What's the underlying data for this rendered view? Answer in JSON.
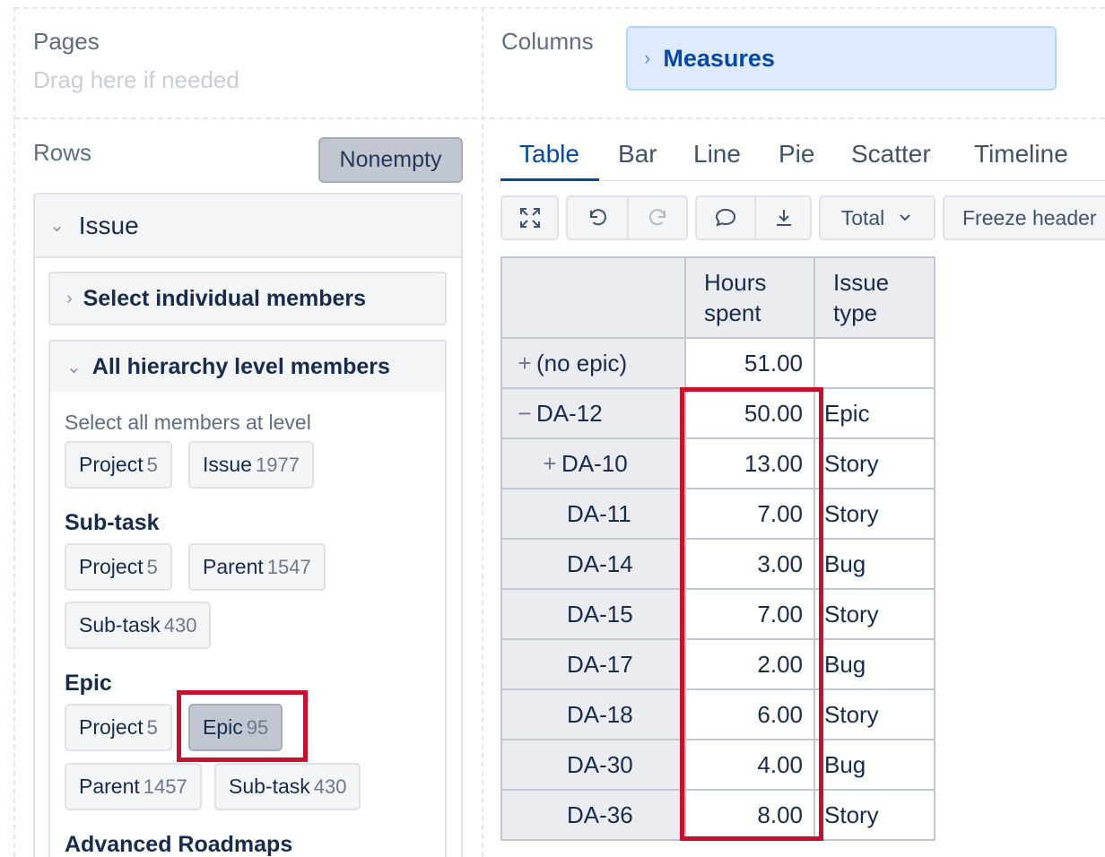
{
  "pages": {
    "title": "Pages",
    "hint": "Drag here if needed"
  },
  "columns": {
    "title": "Columns",
    "measures_label": "Measures"
  },
  "rows": {
    "title": "Rows",
    "nonempty_label": "Nonempty"
  },
  "dimension": {
    "title": "Issue"
  },
  "accordion": {
    "individual_members": "Select individual members",
    "hierarchy_level_members": "All hierarchy level members"
  },
  "levels": {
    "caption": "Select all members at level",
    "top": [
      {
        "label": "Project",
        "count": "5"
      },
      {
        "label": "Issue",
        "count": "1977"
      }
    ],
    "subtask": {
      "title": "Sub-task",
      "chips": [
        {
          "label": "Project",
          "count": "5"
        },
        {
          "label": "Parent",
          "count": "1547"
        },
        {
          "label": "Sub-task",
          "count": "430"
        }
      ]
    },
    "epic": {
      "title": "Epic",
      "chips": [
        {
          "label": "Project",
          "count": "5"
        },
        {
          "label": "Epic",
          "count": "95"
        },
        {
          "label": "Parent",
          "count": "1457"
        },
        {
          "label": "Sub-task",
          "count": "430"
        }
      ]
    },
    "advanced_roadmaps": {
      "title": "Advanced Roadmaps"
    }
  },
  "tabs": [
    "Table",
    "Bar",
    "Line",
    "Pie",
    "Scatter",
    "Timeline"
  ],
  "toolbar": {
    "total_label": "Total",
    "freeze_label": "Freeze header"
  },
  "table": {
    "headers": {
      "hours_line1": "Hours",
      "hours_line2": "spent",
      "type_line1": "Issue",
      "type_line2": "type"
    },
    "rows": [
      {
        "toggle": "+",
        "name": "(no epic)",
        "hours": "51.00",
        "type": ""
      },
      {
        "toggle": "−",
        "name": "DA-12",
        "hours": "50.00",
        "type": "Epic"
      },
      {
        "toggle": "+",
        "name": "DA-10",
        "hours": "13.00",
        "type": "Story"
      },
      {
        "toggle": "",
        "name": "DA-11",
        "hours": "7.00",
        "type": "Story"
      },
      {
        "toggle": "",
        "name": "DA-14",
        "hours": "3.00",
        "type": "Bug"
      },
      {
        "toggle": "",
        "name": "DA-15",
        "hours": "7.00",
        "type": "Story"
      },
      {
        "toggle": "",
        "name": "DA-17",
        "hours": "2.00",
        "type": "Bug"
      },
      {
        "toggle": "",
        "name": "DA-18",
        "hours": "6.00",
        "type": "Story"
      },
      {
        "toggle": "",
        "name": "DA-30",
        "hours": "4.00",
        "type": "Bug"
      },
      {
        "toggle": "",
        "name": "DA-36",
        "hours": "8.00",
        "type": "Story"
      }
    ]
  },
  "colors": {
    "highlight": "#c8102e",
    "accent": "#0747a6",
    "measures_bg": "#deebff"
  }
}
